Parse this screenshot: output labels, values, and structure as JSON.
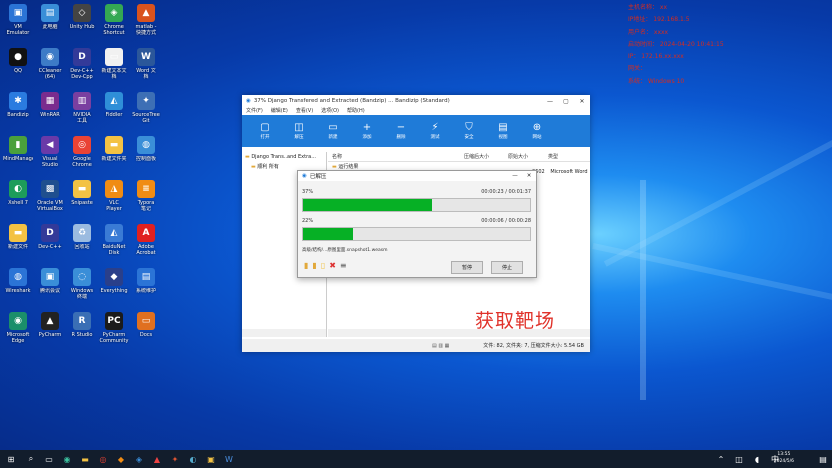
{
  "info_panel": {
    "lines": [
      "主机名称：  xx",
      "IP地址：  192.168.1.5",
      "用户名：  xxxx",
      "启动时间：  2024-04-20 10:41:15",
      "IP：  172.16.xx.xxx",
      "网关：",
      "系统：  Windows 10"
    ]
  },
  "desktop_icons": [
    {
      "label": "VM\nEmulator",
      "color": "#2b74d6",
      "glyph": "▣"
    },
    {
      "label": "此电脑",
      "color": "#3a8ed8",
      "glyph": "▤"
    },
    {
      "label": "Unity Hub",
      "color": "#444444",
      "glyph": "◇"
    },
    {
      "label": "Chrome\nShortcut",
      "color": "#34a853",
      "glyph": "◈"
    },
    {
      "label": "matlab -\n快捷方式",
      "color": "#d9531e",
      "glyph": "▲"
    },
    {
      "label": "QQ",
      "color": "#111111",
      "glyph": "●"
    },
    {
      "label": "CCleaner\n(64)",
      "color": "#3d7bc7",
      "glyph": "◉"
    },
    {
      "label": "Dev-C++\nDev-Cpp",
      "color": "#333a99",
      "glyph": "D"
    },
    {
      "label": "新建文本文\n档",
      "color": "#f1f1f1",
      "glyph": "▭"
    },
    {
      "label": "Word 文\n档",
      "color": "#2b579a",
      "glyph": "W"
    },
    {
      "label": "Bandizip",
      "color": "#2a7be0",
      "glyph": "✱"
    },
    {
      "label": "WinRAR",
      "color": "#7a2c8e",
      "glyph": "▦"
    },
    {
      "label": "NVIDIA\n工具",
      "color": "#7a3fa0",
      "glyph": "▥"
    },
    {
      "label": "Fiddler",
      "color": "#2f8fd8",
      "glyph": "◭"
    },
    {
      "label": "SourceTree\nGit",
      "color": "#3d6fb5",
      "glyph": "✦"
    },
    {
      "label": "MindManager",
      "color": "#4aa03c",
      "glyph": "▮"
    },
    {
      "label": "Visual\nStudio",
      "color": "#6a3aa8",
      "glyph": "◀"
    },
    {
      "label": "Google\nChrome",
      "color": "#ea4335",
      "glyph": "◎"
    },
    {
      "label": "新建文件夹",
      "color": "#f3c244",
      "glyph": "▬"
    },
    {
      "label": "控制面板",
      "color": "#3a8ed8",
      "glyph": "◍"
    },
    {
      "label": "Xshell 7",
      "color": "#1d9c5a",
      "glyph": "◐"
    },
    {
      "label": "Oracle VM\nVirtualBox",
      "color": "#1f4f8f",
      "glyph": "▩"
    },
    {
      "label": "Snipaste",
      "color": "#f3c244",
      "glyph": "▬"
    },
    {
      "label": "VLC\nPlayer",
      "color": "#f08c14",
      "glyph": "◮"
    },
    {
      "label": "Typora\n笔记",
      "color": "#f08c14",
      "glyph": "≡"
    },
    {
      "label": "新建文件",
      "color": "#f3c244",
      "glyph": "▬"
    },
    {
      "label": "Dev-C++",
      "color": "#333a99",
      "glyph": "D"
    },
    {
      "label": "回收站",
      "color": "#9bbbe0",
      "glyph": "♻"
    },
    {
      "label": "BaiduNet\nDisk",
      "color": "#3a7bd5",
      "glyph": "◭"
    },
    {
      "label": "Adobe\nAcrobat",
      "color": "#e02020",
      "glyph": "A"
    },
    {
      "label": "Wireshark",
      "color": "#2b74d6",
      "glyph": "◍"
    },
    {
      "label": "腾讯会议",
      "color": "#3a8ed8",
      "glyph": "▣"
    },
    {
      "label": "Windows\n终端",
      "color": "#3a8ed8",
      "glyph": "◌"
    },
    {
      "label": "Everything",
      "color": "#2a3f8a",
      "glyph": "◆"
    },
    {
      "label": "系统维护",
      "color": "#2b74d6",
      "glyph": "▤"
    },
    {
      "label": "Microsoft\nEdge",
      "color": "#1b8f6a",
      "glyph": "◉"
    },
    {
      "label": "PyCharm",
      "color": "#222222",
      "glyph": "▲"
    },
    {
      "label": "R Studio",
      "color": "#3a6fb5",
      "glyph": "R"
    },
    {
      "label": "PyCharm\nCommunity",
      "color": "#1b1b1b",
      "glyph": "PC"
    },
    {
      "label": "Docs",
      "color": "#e07020",
      "glyph": "▭"
    }
  ],
  "app_window": {
    "title": "37% Django Transfered and Extracted (Bandzip) ...  Bandizip (Standard)",
    "menu": [
      "文件(F)",
      "编辑(E)",
      "查看(V)",
      "选项(O)",
      "帮助(H)"
    ],
    "tools": [
      {
        "icon": "▢",
        "label": "打开"
      },
      {
        "icon": "◫",
        "label": "解压"
      },
      {
        "icon": "▭",
        "label": "新建"
      },
      {
        "icon": "+",
        "label": "添加"
      },
      {
        "icon": "−",
        "label": "删除"
      },
      {
        "icon": "⚡",
        "label": "测试"
      },
      {
        "icon": "⛉",
        "label": "安全"
      },
      {
        "icon": "▤",
        "label": "视图"
      },
      {
        "icon": "⊕",
        "label": "网站"
      }
    ],
    "tree_root": "Django Trans..and Extra...",
    "tree_child": "顺利 所有",
    "columns": [
      "名称",
      "压缩后大小",
      "原始大小",
      "类型"
    ],
    "row_name": "运行结果",
    "row_type_1": "2602",
    "row_type_2": "Microsoft Word",
    "status_text": "文件: 82, 文件夹: 7, 压缩文件大小: 5.54 GB"
  },
  "dialog": {
    "title": "已解压",
    "p1_pct_label": "37%",
    "p1_time": "00:00:23 / 00:01:37",
    "p1_value": 0.57,
    "p2_pct_label": "22%",
    "p2_time": "00:00:06 / 00:00:28",
    "p2_value": 0.22,
    "path": "高级/结构/...原图里面.snapshot1.weasm",
    "btn_pause": "暂停",
    "btn_cancel": "停止"
  },
  "watermark": "获取靶场",
  "taskbar": {
    "time": "13:55",
    "date": "2024/5/6"
  }
}
